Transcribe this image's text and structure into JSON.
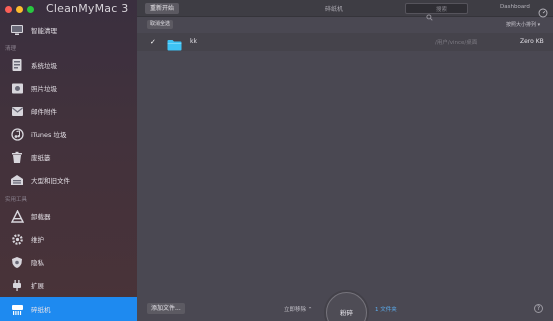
{
  "window": {
    "title": "CleanMyMac 3"
  },
  "sidebar": {
    "top_item": {
      "label": "智能清理",
      "icon": "monitor-icon"
    },
    "section_clean": "清理",
    "clean_items": [
      {
        "label": "系统垃圾",
        "icon": "system-junk-icon"
      },
      {
        "label": "照片垃圾",
        "icon": "photo-junk-icon"
      },
      {
        "label": "邮件附件",
        "icon": "mail-icon"
      },
      {
        "label": "iTunes 垃圾",
        "icon": "music-icon"
      },
      {
        "label": "废纸篓",
        "icon": "trash-bins-icon"
      },
      {
        "label": "大型和旧文件",
        "icon": "large-files-icon"
      }
    ],
    "section_tools": "实用工具",
    "tool_items": [
      {
        "label": "卸载器",
        "icon": "uninstaller-icon"
      },
      {
        "label": "维护",
        "icon": "gear-icon"
      },
      {
        "label": "隐私",
        "icon": "shield-icon"
      },
      {
        "label": "扩展",
        "icon": "plug-icon"
      },
      {
        "label": "碎纸机",
        "icon": "shredder-icon",
        "active": true
      }
    ]
  },
  "toolbar": {
    "restart_label": "重新开始",
    "center_title": "碎纸机",
    "search_placeholder": "搜索",
    "dashboard_label": "Dashboard"
  },
  "list": {
    "deselect_label": "取消全选",
    "sort_label": "按照大小排列 ▾",
    "rows": [
      {
        "checked": "✓",
        "name": "kk",
        "path": "/用户/vince/桌面",
        "size": "Zero KB"
      }
    ]
  },
  "bottom": {
    "add_files_label": "添加文件...",
    "erase_mode_label": "立即移除 ⌃",
    "erase_button_label": "粉碎",
    "file_count": "1 文件夹",
    "help_label": "?"
  },
  "colors": {
    "accent": "#1e8af0",
    "folder": "#3ec3f5",
    "link": "#5cb0f4"
  }
}
